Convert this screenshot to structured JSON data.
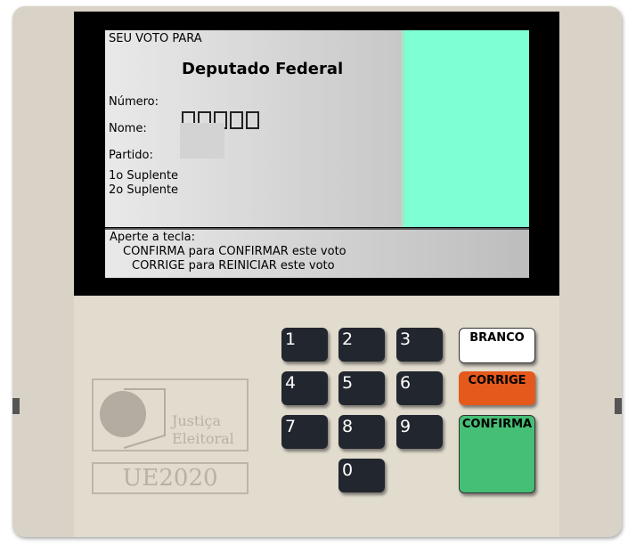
{
  "screen": {
    "header": "SEU VOTO PARA",
    "office": "Deputado Federal",
    "number_label": "Número:",
    "name_label": "Nome:",
    "party_label": "Partido:",
    "substitute1_label": "1o Suplente",
    "substitute2_label": "2o Suplente",
    "number_digits": [
      "",
      "",
      "",
      "",
      ""
    ],
    "candidate_photo_color": "#7fffd4"
  },
  "instructions": {
    "line1": "Aperte a tecla:",
    "line2": "CONFIRMA para CONFIRMAR este voto",
    "line3": "CORRIGE para REINICIAR este voto"
  },
  "keypad": {
    "keys": [
      "1",
      "2",
      "3",
      "4",
      "5",
      "6",
      "7",
      "8",
      "9",
      "0"
    ]
  },
  "function_keys": {
    "branco": "BRANCO",
    "corrige": "CORRIGE",
    "confirma": "CONFIRMA",
    "branco_color": "#ffffff",
    "corrige_color": "#e5591c",
    "confirma_color": "#46bf76"
  },
  "branding": {
    "logo_line1": "Justiça",
    "logo_line2": "Eleitoral",
    "model": "UE2020"
  }
}
